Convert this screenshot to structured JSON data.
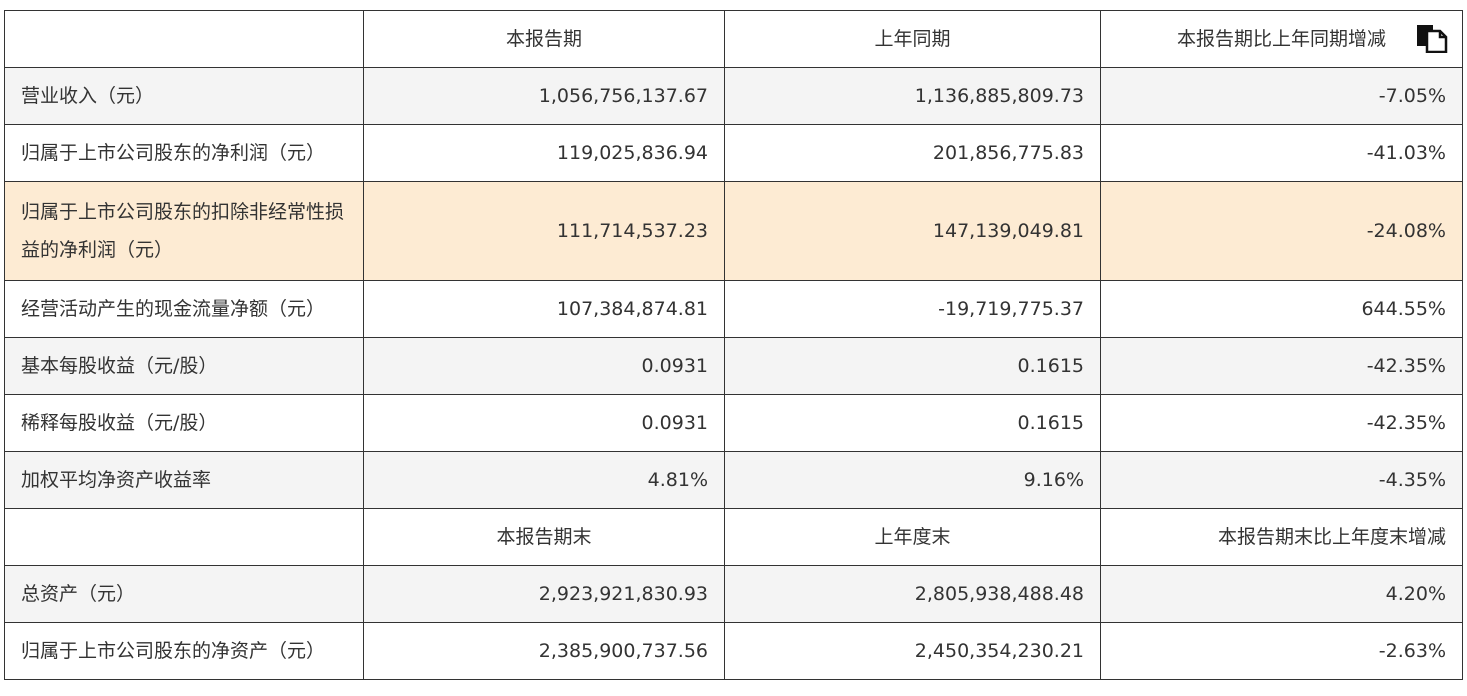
{
  "header": {
    "col1": "",
    "col2": "本报告期",
    "col3": "上年同期",
    "col4": "本报告期比上年同期增减",
    "icon": "copy-icon"
  },
  "rows_a": [
    {
      "label": "营业收入（元）",
      "current": "1,056,756,137.67",
      "prior": "1,136,885,809.73",
      "change": "-7.05%"
    },
    {
      "label": "归属于上市公司股东的净利润（元）",
      "current": "119,025,836.94",
      "prior": "201,856,775.83",
      "change": "-41.03%"
    },
    {
      "label": "归属于上市公司股东的扣除非经常性损益的净利润（元）",
      "current": "111,714,537.23",
      "prior": "147,139,049.81",
      "change": "-24.08%"
    },
    {
      "label": "经营活动产生的现金流量净额（元）",
      "current": "107,384,874.81",
      "prior": "-19,719,775.37",
      "change": "644.55%"
    },
    {
      "label": "基本每股收益（元/股）",
      "current": "0.0931",
      "prior": "0.1615",
      "change": "-42.35%"
    },
    {
      "label": "稀释每股收益（元/股）",
      "current": "0.0931",
      "prior": "0.1615",
      "change": "-42.35%"
    },
    {
      "label": "加权平均净资产收益率",
      "current": "4.81%",
      "prior": "9.16%",
      "change": "-4.35%"
    }
  ],
  "header2": {
    "col1": "",
    "col2": "本报告期末",
    "col3": "上年度末",
    "col4": "本报告期末比上年度末增减"
  },
  "rows_b": [
    {
      "label": "总资产（元）",
      "current": "2,923,921,830.93",
      "prior": "2,805,938,488.48",
      "change": "4.20%"
    },
    {
      "label": "归属于上市公司股东的净资产（元）",
      "current": "2,385,900,737.56",
      "prior": "2,450,354,230.21",
      "change": "-2.63%"
    }
  ]
}
